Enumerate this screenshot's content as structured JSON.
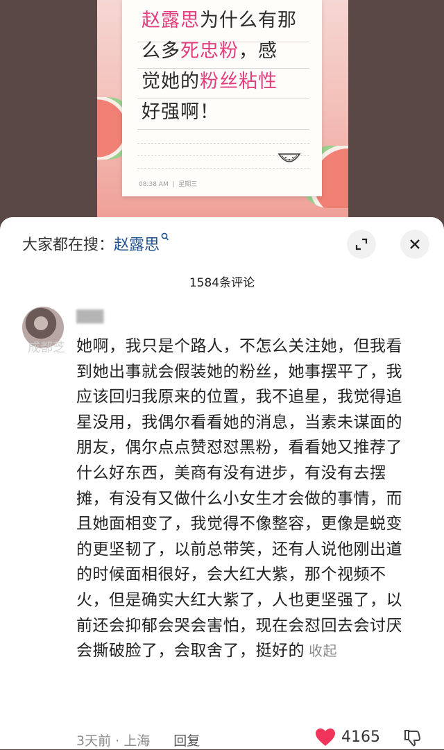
{
  "note": {
    "line1_pink": "赵露思",
    "line1_rest": "为什么有那",
    "line2_a": "么多",
    "line2_pink": "死忠粉",
    "line2_b": "，感",
    "line3_a": "觉她的",
    "line3_pink": "粉丝粘性",
    "line4": "好强啊！",
    "time": "08:38 AM",
    "day": "星期三"
  },
  "search": {
    "prefix": "大家都在搜：",
    "keyword": "赵露思"
  },
  "comments_count": "1584条评论",
  "comment": {
    "watermark": "成都芝",
    "text": "她啊，我只是个路人，不怎么关注她，但我看到她出事就会假装她的粉丝，她事摆平了，我应该回归我原来的位置，我不追星，我觉得追星没用，我偶尔看看她的消息，当素未谋面的朋友，偶尔点点赞怼怼黑粉，看看她又推荐了什么好东西，美商有没有进步，有没有去摆摊，有没有又做什么小女生才会做的事情，而且她面相变了，我觉得不像整容，更像是蜕变的更坚韧了，以前总带笑，还有人说他刚出道的时候面相很好，会大红大紫，那个视频不火，但是确实大红大紫了，人也更坚强了，以前还会抑郁会哭会害怕，现在会怼回去会讨厌会撕破脸了，会取舍了，挺好的",
    "collapse": "收起",
    "time": "3天前",
    "location": "上海",
    "reply": "回复",
    "likes": "4165"
  },
  "colors": {
    "accent_pink": "#e23d7e",
    "keyword_blue": "#1f4f8e",
    "like_red": "#f0345a"
  },
  "icons": [
    "search-icon",
    "expand-icon",
    "close-icon",
    "heart-icon",
    "dislike-icon"
  ]
}
